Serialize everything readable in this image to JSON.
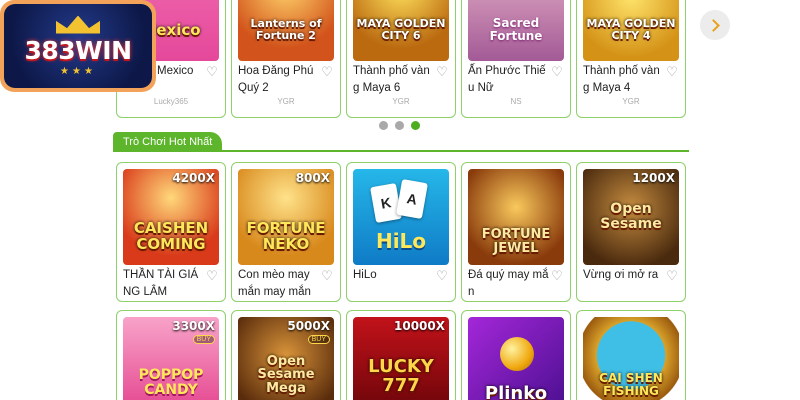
{
  "brand": {
    "logo_text": "383WIN"
  },
  "carousel": {
    "games": [
      {
        "name": "Mexico",
        "provider": "Lucky365",
        "thumb_text": "Mexico"
      },
      {
        "name": "Hoa Đăng Phú Quý 2",
        "provider": "YGR",
        "thumb_text": "Lanterns of Fortune 2"
      },
      {
        "name": "Thành phố vàng Maya 6",
        "provider": "YGR",
        "thumb_text": "MAYA GOLDEN CITY 6"
      },
      {
        "name": "Ấn Phước Thiếu Nữ",
        "provider": "NS",
        "thumb_text": "Sacred Fortune"
      },
      {
        "name": "Thành phố vàng Maya 4",
        "provider": "YGR",
        "thumb_text": "MAYA GOLDEN CITY 4"
      }
    ],
    "pager_active": 3,
    "pager_count": 3
  },
  "section": {
    "title": "Trò Chơi Hot Nhất"
  },
  "hot_games": [
    {
      "name": "THẦN TÀI GIÁNG LÂM",
      "thumb_text": "CAISHEN COMING",
      "multiplier": "4200X",
      "buy": ""
    },
    {
      "name": "Con mèo may mắn may mắn",
      "thumb_text": "FORTUNE NEKO",
      "multiplier": "800X",
      "buy": ""
    },
    {
      "name": "HiLo",
      "thumb_text": "HiLo",
      "multiplier": "",
      "buy": ""
    },
    {
      "name": "Đá quý may mắn",
      "thumb_text": "FORTUNE JEWEL",
      "multiplier": "",
      "buy": ""
    },
    {
      "name": "Vừng ơi mở ra",
      "thumb_text": "Open Sesame",
      "multiplier": "1200X",
      "buy": ""
    },
    {
      "name": "",
      "thumb_text": "POPPOP CANDY",
      "multiplier": "3300X",
      "buy": "BUY"
    },
    {
      "name": "",
      "thumb_text": "Open Sesame Mega",
      "multiplier": "5000X",
      "buy": "BUY"
    },
    {
      "name": "",
      "thumb_text": "LUCKY 777",
      "multiplier": "10000X",
      "buy": ""
    },
    {
      "name": "",
      "thumb_text": "Plinko",
      "multiplier": "",
      "buy": ""
    },
    {
      "name": "",
      "thumb_text": "CAI SHEN FISHING",
      "multiplier": "",
      "buy": ""
    }
  ],
  "icons": {
    "favorite": "heart-icon",
    "next": "chevron-right-icon"
  },
  "colors": {
    "accent": "#5cb52b",
    "card_border": "#8ed06a",
    "logo_bg": "#0d1848",
    "logo_border": "#f3a25a"
  }
}
